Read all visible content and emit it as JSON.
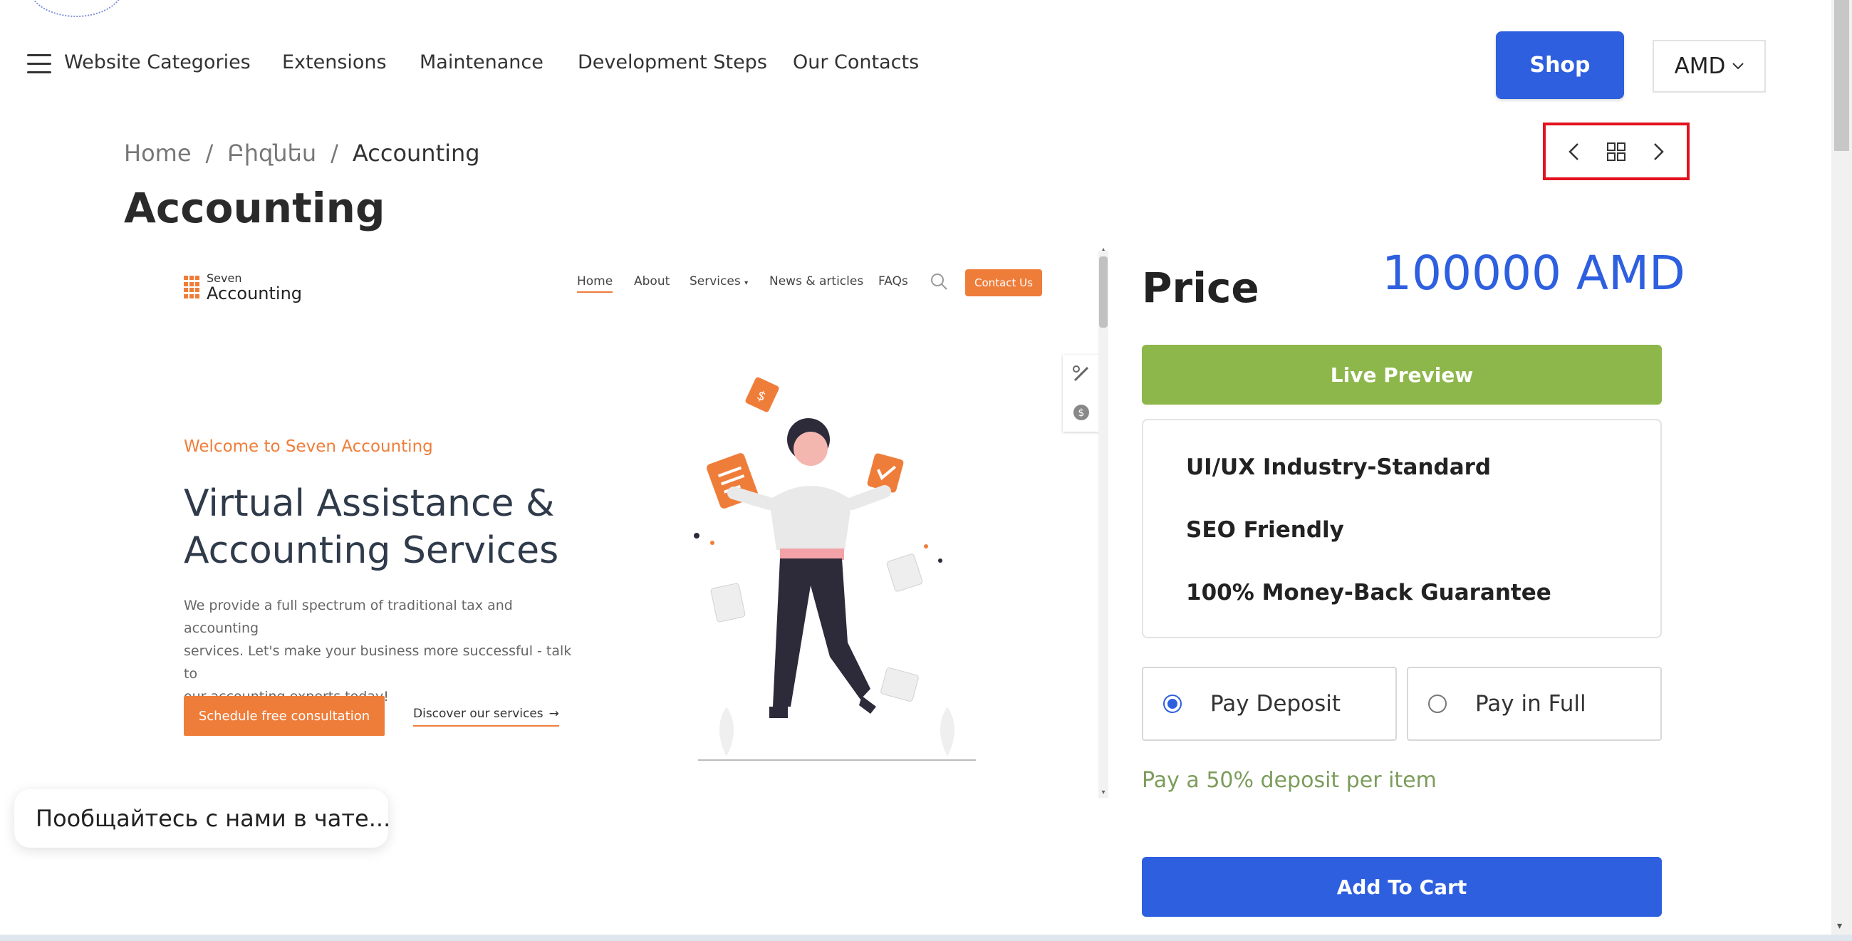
{
  "header": {
    "nav": {
      "categories": "Website Categories",
      "extensions": "Extensions",
      "maintenance": "Maintenance",
      "development_steps": "Development Steps",
      "our_contacts": "Our Contacts"
    },
    "shop_label": "Shop",
    "currency": "AMD"
  },
  "breadcrumb": {
    "home": "Home",
    "separator": "/",
    "category": "Բիզնես",
    "current": "Accounting"
  },
  "page_title": "Accounting",
  "preview": {
    "logo_small": "Seven",
    "logo_big": "Accounting",
    "nav": {
      "home": "Home",
      "about": "About",
      "services": "Services",
      "news": "News & articles",
      "faqs": "FAQs"
    },
    "contact_label": "Contact Us",
    "welcome": "Welcome to Seven Accounting",
    "hero_line1": "Virtual Assistance &",
    "hero_line2": "Accounting Services",
    "desc_line1": "We provide a full spectrum of traditional tax and accounting",
    "desc_line2": "services. Let's make your business more successful - talk to",
    "desc_line3": "our accounting experts today!",
    "cta": "Schedule free consultation",
    "discover": "Discover our services",
    "accent_color": "#ef7d3a"
  },
  "product": {
    "price_label": "Price",
    "price_value": "100000 AMD",
    "live_preview": "Live Preview",
    "features": [
      "UI/UX Industry-Standard",
      "SEO Friendly",
      "100% Money-Back Guarantee"
    ],
    "pay_deposit": "Pay Deposit",
    "pay_full": "Pay in Full",
    "selected_payment": "Pay Deposit",
    "deposit_note": "Pay a 50% deposit per item",
    "add_to_cart": "Add To Cart"
  },
  "chat": {
    "label": "Пообщайтесь с нами в чате..."
  },
  "colors": {
    "primary": "#2e5fdf",
    "live_preview": "#8db74b",
    "highlight_box": "#e3131d"
  }
}
